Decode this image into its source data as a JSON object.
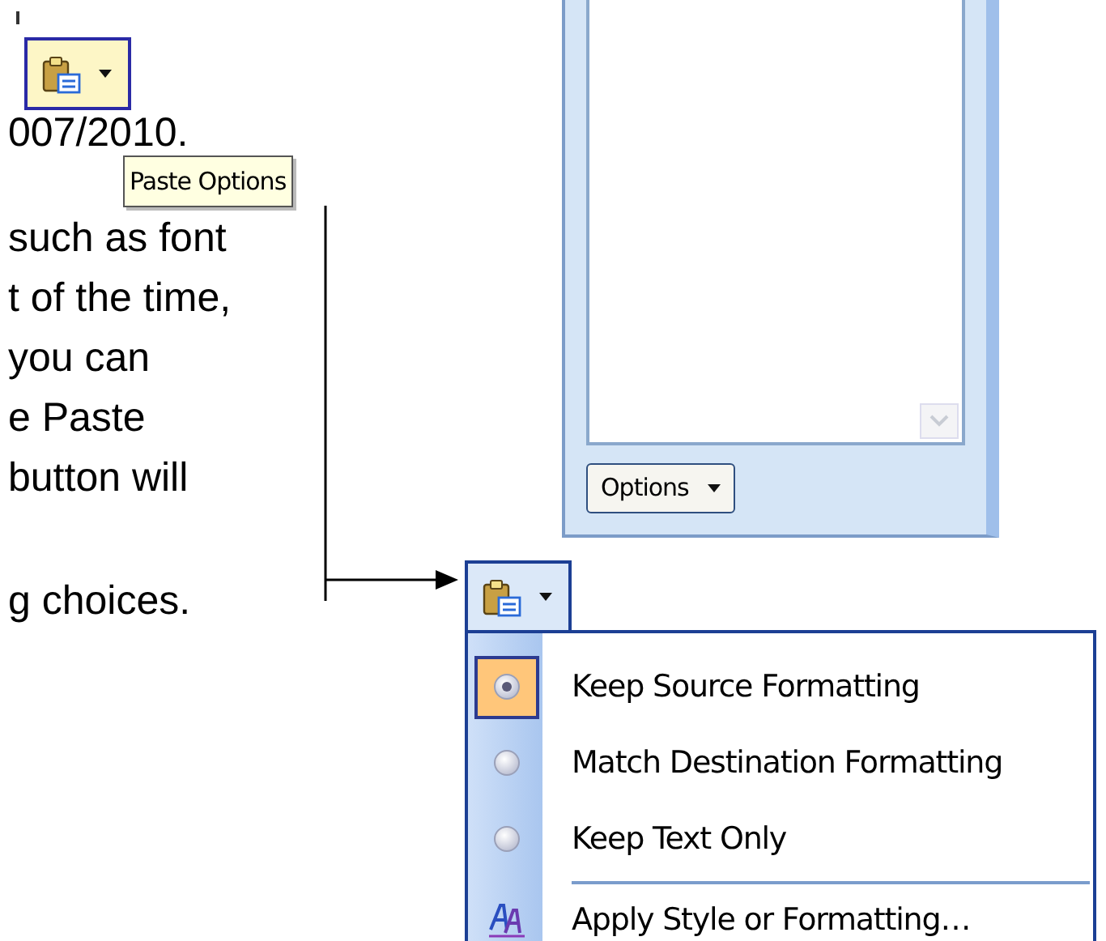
{
  "document": {
    "paragraph_1": [
      "007/2010."
    ],
    "paragraph_2": [
      "such as font",
      "t of the time,",
      "you can",
      "e Paste",
      "button will"
    ],
    "paragraph_3": [
      "g choices."
    ]
  },
  "paste_buttons": [
    {
      "hover": true,
      "expanded": false
    },
    {
      "hover": false,
      "expanded": true
    }
  ],
  "tooltip": {
    "text": "Paste Options"
  },
  "task_pane": {
    "options_button": "Options"
  },
  "menu": {
    "items": [
      {
        "kind": "radio",
        "label": "Keep Source Formatting",
        "selected": true
      },
      {
        "kind": "radio",
        "label": "Match Destination Formatting",
        "selected": false
      },
      {
        "kind": "radio",
        "label": "Keep Text Only",
        "selected": false
      },
      {
        "kind": "command",
        "label": "Apply Style or Formatting…"
      }
    ]
  }
}
